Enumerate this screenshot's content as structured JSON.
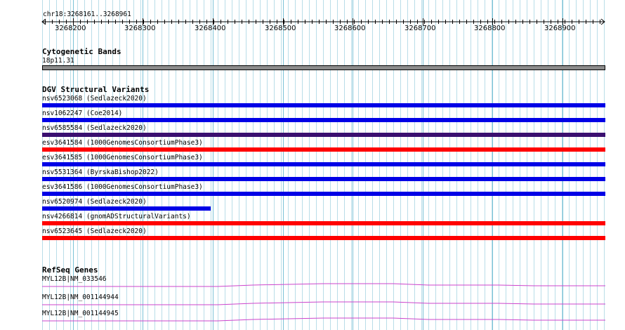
{
  "ruler": {
    "label": "chr18:3268161..3268961",
    "ticks": [
      "3268200",
      "3268300",
      "3268400",
      "3268500",
      "3268600",
      "3268700",
      "3268800",
      "3268900"
    ]
  },
  "tracks": {
    "cytogenetic": {
      "title": "Cytogenetic Bands",
      "band_label": "18p11.31",
      "band_color": "#8c8c8c"
    },
    "dgv": {
      "title": "DGV Structural Variants",
      "colors": {
        "loss": "#0000e6",
        "gain": "#ff0000",
        "mixed": "#3a1070"
      },
      "features": [
        {
          "label": "nsv6523068 (Sedlazeck2020)",
          "type": "loss"
        },
        {
          "label": "nsv1062247 (Coe2014)",
          "type": "loss"
        },
        {
          "label": "nsv6585584 (Sedlazeck2020)",
          "type": "mixed"
        },
        {
          "label": "esv3641584 (1000GenomesConsortiumPhase3)",
          "type": "gain"
        },
        {
          "label": "esv3641585 (1000GenomesConsortiumPhase3)",
          "type": "loss"
        },
        {
          "label": "nsv5531364 (ByrskaBishop2022)",
          "type": "loss"
        },
        {
          "label": "esv3641586 (1000GenomesConsortiumPhase3)",
          "type": "loss"
        },
        {
          "label": "nsv6520974 (Sedlazeck2020)",
          "type": "loss"
        },
        {
          "label": "nsv4266814 (gnomADStructuralVariants)",
          "type": "gain"
        },
        {
          "label": "nsv6523645 (Sedlazeck2020)",
          "type": "gain"
        }
      ]
    },
    "refseq": {
      "title": "RefSeq Genes",
      "color": "#cc44cc",
      "genes": [
        {
          "label": "MYL12B|NM_033546"
        },
        {
          "label": "MYL12B|NM_001144944"
        },
        {
          "label": "MYL12B|NM_001144945"
        }
      ]
    }
  }
}
